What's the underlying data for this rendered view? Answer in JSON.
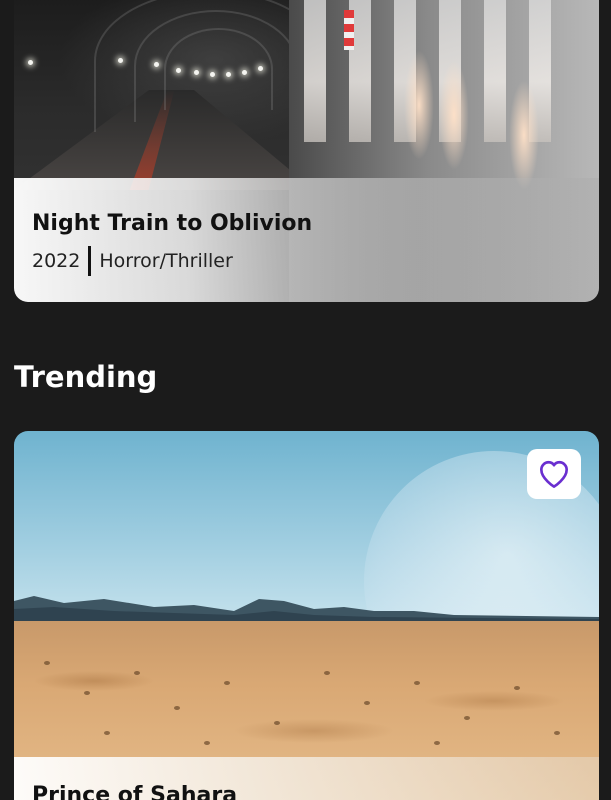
{
  "featured": {
    "title": "Night Train to Oblivion",
    "year": "2022",
    "genre": "Horror/Thriller"
  },
  "section": {
    "heading": "Trending"
  },
  "trending": [
    {
      "title": "Prince of Sahara",
      "favorite_icon": "heart-icon"
    }
  ],
  "colors": {
    "background": "#1b1b1b",
    "accent": "#6a2fd0",
    "heading_text": "#ffffff"
  }
}
